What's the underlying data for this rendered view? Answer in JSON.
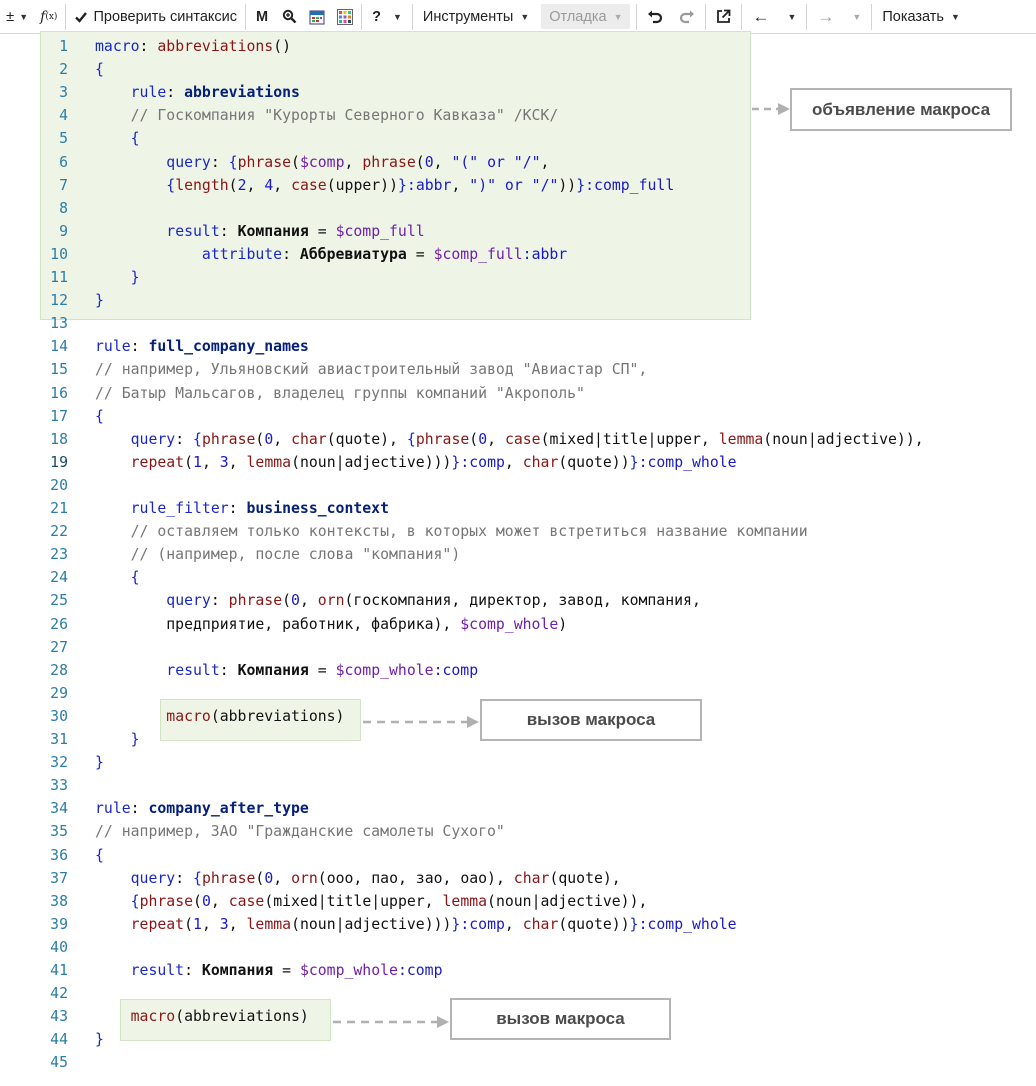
{
  "toolbar": {
    "plus_minus": "±",
    "fx": "f(x)",
    "check_syntax": "Проверить синтаксис",
    "m_label": "M",
    "help": "?",
    "tools": "Инструменты",
    "debug": "Отладка",
    "show": "Показать"
  },
  "icons": [
    "plus-minus-icon",
    "function-icon",
    "check-icon",
    "search-zoom-icon",
    "calendar-icon",
    "color-grid-icon",
    "help-icon",
    "undo-icon",
    "redo-icon",
    "external-link-icon",
    "arrow-left-icon",
    "arrow-right-icon"
  ],
  "annotations": {
    "macro_declaration": "объявление макроса",
    "macro_call_1": "вызов макроса",
    "macro_call_2": "вызов макроса"
  },
  "lines": [
    {
      "n": "1",
      "t": [
        [
          "kw",
          "macro"
        ],
        [
          "tx",
          ": "
        ],
        [
          "fn",
          "abbreviations"
        ],
        [
          "tx",
          "()"
        ]
      ]
    },
    {
      "n": "2",
      "t": [
        [
          "kw",
          "{"
        ]
      ]
    },
    {
      "n": "3",
      "t": [
        [
          "tx",
          "    "
        ],
        [
          "kw",
          "rule"
        ],
        [
          "tx",
          ": "
        ],
        [
          "kwb",
          "abbreviations"
        ]
      ]
    },
    {
      "n": "4",
      "t": [
        [
          "tx",
          "    "
        ],
        [
          "cm",
          "// Госкомпания \"Курорты Северного Кавказа\" /КСК/"
        ]
      ]
    },
    {
      "n": "5",
      "t": [
        [
          "tx",
          "    "
        ],
        [
          "kw",
          "{"
        ]
      ]
    },
    {
      "n": "6",
      "t": [
        [
          "tx",
          "        "
        ],
        [
          "kw",
          "query"
        ],
        [
          "tx",
          ": "
        ],
        [
          "kw",
          "{"
        ],
        [
          "fn",
          "phrase"
        ],
        [
          "tx",
          "("
        ],
        [
          "va",
          "$comp"
        ],
        [
          "tx",
          ", "
        ],
        [
          "fn",
          "phrase"
        ],
        [
          "tx",
          "("
        ],
        [
          "nu",
          "0"
        ],
        [
          "tx",
          ", "
        ],
        [
          "st",
          "\"(\" or \"/\""
        ],
        [
          "tx",
          ","
        ]
      ]
    },
    {
      "n": "7",
      "t": [
        [
          "tx",
          "        "
        ],
        [
          "kw",
          "{"
        ],
        [
          "fn",
          "length"
        ],
        [
          "tx",
          "("
        ],
        [
          "nu",
          "2"
        ],
        [
          "tx",
          ", "
        ],
        [
          "nu",
          "4"
        ],
        [
          "tx",
          ", "
        ],
        [
          "fn",
          "case"
        ],
        [
          "tx",
          "(upper))"
        ],
        [
          "kw",
          "}"
        ],
        [
          "cp",
          ":abbr"
        ],
        [
          "tx",
          ", "
        ],
        [
          "st",
          "\")\" or \"/\""
        ],
        [
          "tx",
          "))"
        ],
        [
          "kw",
          "}"
        ],
        [
          "cp",
          ":comp_full"
        ]
      ]
    },
    {
      "n": "8",
      "t": []
    },
    {
      "n": "9",
      "t": [
        [
          "tx",
          "        "
        ],
        [
          "kw",
          "result"
        ],
        [
          "tx",
          ": "
        ],
        [
          "lb",
          "Компания"
        ],
        [
          "tx",
          " = "
        ],
        [
          "va",
          "$comp_full"
        ]
      ]
    },
    {
      "n": "10",
      "t": [
        [
          "tx",
          "            "
        ],
        [
          "kw",
          "attribute"
        ],
        [
          "tx",
          ": "
        ],
        [
          "lb",
          "Аббревиатура"
        ],
        [
          "tx",
          " = "
        ],
        [
          "va",
          "$comp_full"
        ],
        [
          "cp",
          ":abbr"
        ]
      ]
    },
    {
      "n": "11",
      "t": [
        [
          "tx",
          "    "
        ],
        [
          "kw",
          "}"
        ]
      ]
    },
    {
      "n": "12",
      "t": [
        [
          "kw",
          "}"
        ]
      ]
    },
    {
      "n": "13",
      "t": []
    },
    {
      "n": "14",
      "t": [
        [
          "kw",
          "rule"
        ],
        [
          "tx",
          ": "
        ],
        [
          "kwb",
          "full_company_names"
        ]
      ]
    },
    {
      "n": "15",
      "t": [
        [
          "cm",
          "// например, Ульяновский авиастроительный завод \"Авиастар СП\","
        ]
      ]
    },
    {
      "n": "16",
      "t": [
        [
          "cm",
          "// Батыр Мальсагов, владелец группы компаний \"Акрополь\""
        ]
      ]
    },
    {
      "n": "17",
      "t": [
        [
          "kw",
          "{"
        ]
      ]
    },
    {
      "n": "18",
      "t": [
        [
          "tx",
          "    "
        ],
        [
          "kw",
          "query"
        ],
        [
          "tx",
          ": "
        ],
        [
          "kw",
          "{"
        ],
        [
          "fn",
          "phrase"
        ],
        [
          "tx",
          "("
        ],
        [
          "nu",
          "0"
        ],
        [
          "tx",
          ", "
        ],
        [
          "fn",
          "char"
        ],
        [
          "tx",
          "(quote), "
        ],
        [
          "kw",
          "{"
        ],
        [
          "fn",
          "phrase"
        ],
        [
          "tx",
          "("
        ],
        [
          "nu",
          "0"
        ],
        [
          "tx",
          ", "
        ],
        [
          "fn",
          "case"
        ],
        [
          "tx",
          "(mixed|title|upper, "
        ],
        [
          "fn",
          "lemma"
        ],
        [
          "tx",
          "(noun|adjective)),"
        ]
      ]
    },
    {
      "n": "19",
      "cur": true,
      "t": [
        [
          "tx",
          "    "
        ],
        [
          "fn",
          "repeat"
        ],
        [
          "tx",
          "("
        ],
        [
          "nu",
          "1"
        ],
        [
          "tx",
          ", "
        ],
        [
          "nu",
          "3"
        ],
        [
          "tx",
          ", "
        ],
        [
          "fn",
          "lemma"
        ],
        [
          "tx",
          "(noun|adjective)))"
        ],
        [
          "kw",
          "}"
        ],
        [
          "cp",
          ":comp"
        ],
        [
          "tx",
          ", "
        ],
        [
          "fn",
          "char"
        ],
        [
          "tx",
          "(quote))"
        ],
        [
          "kw",
          "}"
        ],
        [
          "cp",
          ":comp_whole"
        ]
      ]
    },
    {
      "n": "20",
      "t": []
    },
    {
      "n": "21",
      "t": [
        [
          "tx",
          "    "
        ],
        [
          "kw",
          "rule_filter"
        ],
        [
          "tx",
          ": "
        ],
        [
          "kwb",
          "business_context"
        ]
      ]
    },
    {
      "n": "22",
      "t": [
        [
          "tx",
          "    "
        ],
        [
          "cm",
          "// оставляем только контексты, в которых может встретиться название компании"
        ]
      ]
    },
    {
      "n": "23",
      "t": [
        [
          "tx",
          "    "
        ],
        [
          "cm",
          "// (например, после слова \"компания\")"
        ]
      ]
    },
    {
      "n": "24",
      "t": [
        [
          "tx",
          "    "
        ],
        [
          "kw",
          "{"
        ]
      ]
    },
    {
      "n": "25",
      "t": [
        [
          "tx",
          "        "
        ],
        [
          "kw",
          "query"
        ],
        [
          "tx",
          ": "
        ],
        [
          "fn",
          "phrase"
        ],
        [
          "tx",
          "("
        ],
        [
          "nu",
          "0"
        ],
        [
          "tx",
          ", "
        ],
        [
          "fn",
          "orn"
        ],
        [
          "tx",
          "(госкомпания, директор, завод, компания,"
        ]
      ]
    },
    {
      "n": "26",
      "t": [
        [
          "tx",
          "        предприятие, работник, фабрика), "
        ],
        [
          "va",
          "$comp_whole"
        ],
        [
          "tx",
          ")"
        ]
      ]
    },
    {
      "n": "27",
      "t": []
    },
    {
      "n": "28",
      "t": [
        [
          "tx",
          "        "
        ],
        [
          "kw",
          "result"
        ],
        [
          "tx",
          ": "
        ],
        [
          "lb",
          "Компания"
        ],
        [
          "tx",
          " = "
        ],
        [
          "va",
          "$comp_whole"
        ],
        [
          "cp",
          ":comp"
        ]
      ]
    },
    {
      "n": "29",
      "t": []
    },
    {
      "n": "30",
      "t": [
        [
          "tx",
          "        "
        ],
        [
          "fn",
          "macro"
        ],
        [
          "tx",
          "(abbreviations)"
        ]
      ]
    },
    {
      "n": "31",
      "t": [
        [
          "tx",
          "    "
        ],
        [
          "kw",
          "}"
        ]
      ]
    },
    {
      "n": "32",
      "t": [
        [
          "kw",
          "}"
        ]
      ]
    },
    {
      "n": "33",
      "t": []
    },
    {
      "n": "34",
      "t": [
        [
          "kw",
          "rule"
        ],
        [
          "tx",
          ": "
        ],
        [
          "kwb",
          "company_after_type"
        ]
      ]
    },
    {
      "n": "35",
      "t": [
        [
          "cm",
          "// например, ЗАО \"Гражданские самолеты Сухого\""
        ]
      ]
    },
    {
      "n": "36",
      "t": [
        [
          "kw",
          "{"
        ]
      ]
    },
    {
      "n": "37",
      "t": [
        [
          "tx",
          "    "
        ],
        [
          "kw",
          "query"
        ],
        [
          "tx",
          ": "
        ],
        [
          "kw",
          "{"
        ],
        [
          "fn",
          "phrase"
        ],
        [
          "tx",
          "("
        ],
        [
          "nu",
          "0"
        ],
        [
          "tx",
          ", "
        ],
        [
          "fn",
          "orn"
        ],
        [
          "tx",
          "(ооо, пао, зао, оао), "
        ],
        [
          "fn",
          "char"
        ],
        [
          "tx",
          "(quote),"
        ]
      ]
    },
    {
      "n": "38",
      "t": [
        [
          "tx",
          "    "
        ],
        [
          "kw",
          "{"
        ],
        [
          "fn",
          "phrase"
        ],
        [
          "tx",
          "("
        ],
        [
          "nu",
          "0"
        ],
        [
          "tx",
          ", "
        ],
        [
          "fn",
          "case"
        ],
        [
          "tx",
          "(mixed|title|upper, "
        ],
        [
          "fn",
          "lemma"
        ],
        [
          "tx",
          "(noun|adjective)),"
        ]
      ]
    },
    {
      "n": "39",
      "t": [
        [
          "tx",
          "    "
        ],
        [
          "fn",
          "repeat"
        ],
        [
          "tx",
          "("
        ],
        [
          "nu",
          "1"
        ],
        [
          "tx",
          ", "
        ],
        [
          "nu",
          "3"
        ],
        [
          "tx",
          ", "
        ],
        [
          "fn",
          "lemma"
        ],
        [
          "tx",
          "(noun|adjective)))"
        ],
        [
          "kw",
          "}"
        ],
        [
          "cp",
          ":comp"
        ],
        [
          "tx",
          ", "
        ],
        [
          "fn",
          "char"
        ],
        [
          "tx",
          "(quote))"
        ],
        [
          "kw",
          "}"
        ],
        [
          "cp",
          ":comp_whole"
        ]
      ]
    },
    {
      "n": "40",
      "t": []
    },
    {
      "n": "41",
      "t": [
        [
          "tx",
          "    "
        ],
        [
          "kw",
          "result"
        ],
        [
          "tx",
          ": "
        ],
        [
          "lb",
          "Компания"
        ],
        [
          "tx",
          " = "
        ],
        [
          "va",
          "$comp_whole"
        ],
        [
          "cp",
          ":comp"
        ]
      ]
    },
    {
      "n": "42",
      "t": []
    },
    {
      "n": "43",
      "t": [
        [
          "tx",
          "    "
        ],
        [
          "fn",
          "macro"
        ],
        [
          "tx",
          "(abbreviations)"
        ]
      ]
    },
    {
      "n": "44",
      "t": [
        [
          "kw",
          "}"
        ]
      ]
    },
    {
      "n": "45",
      "t": []
    }
  ]
}
